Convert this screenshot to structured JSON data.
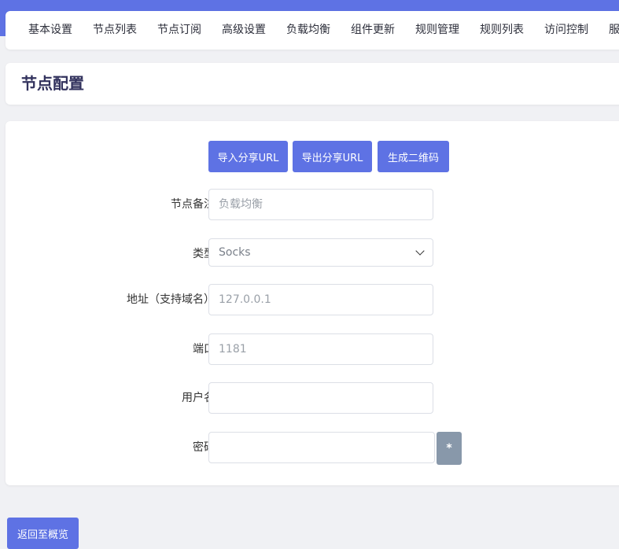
{
  "tabs": [
    "基本设置",
    "节点列表",
    "节点订阅",
    "高级设置",
    "负载均衡",
    "组件更新",
    "规则管理",
    "规则列表",
    "访问控制",
    "服务"
  ],
  "page_title": "节点配置",
  "actions": {
    "import_url": "导入分享URL",
    "export_url": "导出分享URL",
    "qrcode": "生成二维码"
  },
  "form": {
    "remark": {
      "label": "节点备注",
      "placeholder": "负载均衡",
      "value": ""
    },
    "type": {
      "label": "类型",
      "value": "Socks"
    },
    "address": {
      "label": "地址（支持域名）",
      "placeholder": "127.0.0.1",
      "value": ""
    },
    "port": {
      "label": "端口",
      "placeholder": "1181",
      "value": ""
    },
    "username": {
      "label": "用户名",
      "value": ""
    },
    "password": {
      "label": "密码",
      "value": "",
      "toggle": "*"
    }
  },
  "back_button": "返回至概览",
  "colors": {
    "accent": "#5e72e4",
    "secondary": "#8898aa"
  }
}
